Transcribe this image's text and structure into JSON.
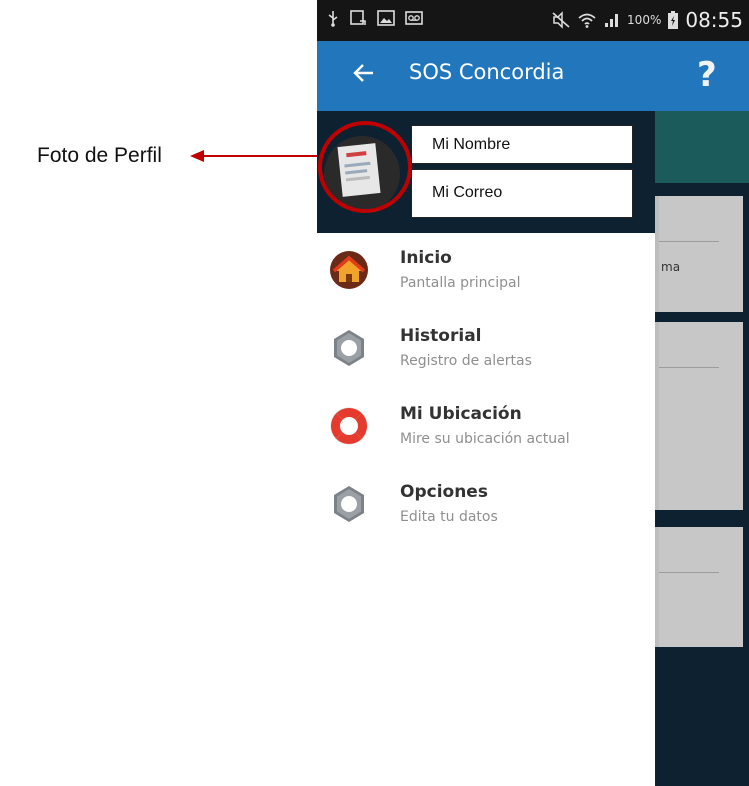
{
  "annotation": {
    "label": "Foto de Perfil",
    "arrow_color": "#c00000"
  },
  "status_bar": {
    "battery_percent": "100%",
    "time": "08:55",
    "icons": [
      "usb-icon",
      "screenshot-icon",
      "image-icon",
      "voicemail-icon",
      "mute-icon",
      "wifi-icon",
      "signal-icon",
      "battery-icon"
    ]
  },
  "app_bar": {
    "title": "SOS Concordia",
    "back_icon": "back-arrow-icon",
    "help_icon": "?",
    "color": "#2276bb"
  },
  "drawer": {
    "profile": {
      "name": "Mi Nombre",
      "email": "Mi Correo",
      "avatar_icon": "profile-photo",
      "highlight_color": "#c00000"
    },
    "items": [
      {
        "title": "Inicio",
        "subtitle": "Pantalla principal",
        "icon": "home-icon"
      },
      {
        "title": "Historial",
        "subtitle": "Registro de alertas",
        "icon": "gear-icon"
      },
      {
        "title": "Mi Ubicación",
        "subtitle": "Mire su ubicación actual",
        "icon": "lifebuoy-icon"
      },
      {
        "title": "Opciones",
        "subtitle": "Edita tu datos",
        "icon": "gear-icon"
      }
    ]
  },
  "background_content": {
    "card_fragment": "ma"
  },
  "colors": {
    "header_dark": "#0d2131",
    "drawer_bg": "#ffffff",
    "teal_accent": "#1c5b5b"
  }
}
